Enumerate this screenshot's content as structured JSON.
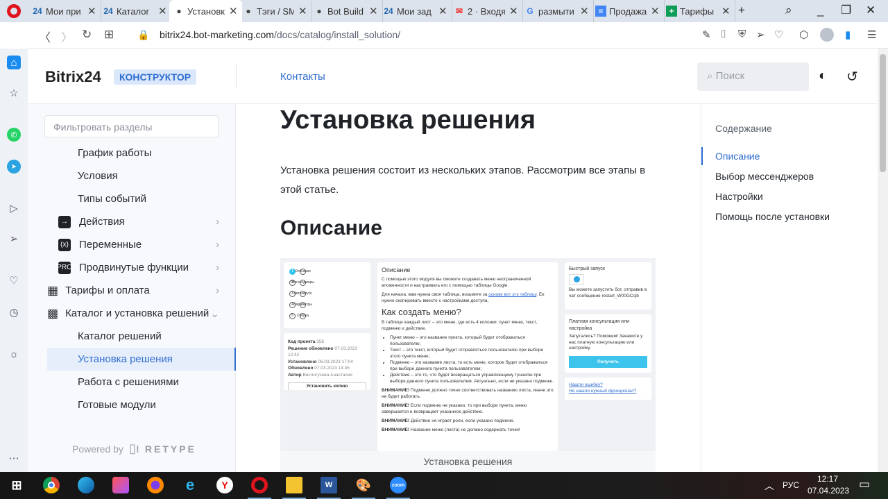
{
  "browser": {
    "tabs": [
      {
        "icon": "24",
        "title": "Мои при"
      },
      {
        "icon": "24",
        "title": "Каталог"
      },
      {
        "icon": "globe",
        "title": "Установк",
        "active": true
      },
      {
        "icon": "globe",
        "title": "Тэги / SM"
      },
      {
        "icon": "globe",
        "title": "Bot Build"
      },
      {
        "icon": "24",
        "title": "Мои зад"
      },
      {
        "icon": "mail",
        "title": "2 · Входя"
      },
      {
        "icon": "G",
        "title": "размыти"
      },
      {
        "icon": "docs",
        "title": "Продажа"
      },
      {
        "icon": "sheets",
        "title": "Тарифы"
      }
    ],
    "url_host": "bitrix24.bot-marketing.com",
    "url_path": "/docs/catalog/install_solution/"
  },
  "header": {
    "logo": "Bitrix24",
    "badge": "КОНСТРУКТОР",
    "contacts": "Контакты",
    "search_placeholder": "Поиск"
  },
  "sidebar": {
    "filter_placeholder": "Фильтровать разделы",
    "items": [
      {
        "label": "График работы"
      },
      {
        "label": "Условия"
      },
      {
        "label": "Типы событий"
      },
      {
        "label": "Действия",
        "icon": "→"
      },
      {
        "label": "Переменные",
        "icon": "(x)"
      },
      {
        "label": "Продвинутые функции",
        "icon": "PRO"
      },
      {
        "label": "Тарифы и оплата"
      },
      {
        "label": "Каталог и установка решений"
      },
      {
        "label": "Каталог решений"
      },
      {
        "label": "Установка решения"
      },
      {
        "label": "Работа с решениями"
      },
      {
        "label": "Готовые модули"
      }
    ],
    "powered_by": "Powered by",
    "retype": "RETYPE"
  },
  "main": {
    "title": "Установка решения",
    "intro": "Установка решения состоит из нескольких этапов. Рассмотрим все этапы в этой статье.",
    "h2": "Описание",
    "caption": "Установка решения",
    "shot": {
      "steps": [
        "Описание",
        "Мессенджеры",
        "Автозапуск",
        "Параметры",
        "Сборка"
      ],
      "meta": [
        [
          "Код проекта",
          "358"
        ],
        [
          "Решение обновлено",
          "07.03.2023 12:42"
        ],
        [
          "Установлено",
          "06.03.2023 17:04"
        ],
        [
          "Обновлено",
          "07.03.2023 14:45"
        ],
        [
          "Автор",
          "Вислогузова Анастасия"
        ]
      ],
      "copy_btn": "Установить копию",
      "art_title": "Описание",
      "p1": "С помощью этого модуля вы сможете создавать меню неограниченной вложенности и настраивать его с помощью таблицы Google.",
      "p2a": "Для начала, вам нужна своя таблица, возьмите за ",
      "p2link": "основу вот эту таблицу",
      "p2b": ". Ее нужно скопировать вместе с настройками доступа.",
      "h3": "Как создать меню?",
      "p3": "В таблице каждый лист – это меню, где есть 4 колонки: пункт меню, текст, подменю и действие.",
      "bullets": [
        "Пункт меню – это название пункта, который будет отображаться пользователю;",
        "Текст – это текст, который будет отправляться пользователю при выборе этого пункта меню;",
        "Подменю – это название листа, то есть меню, которое будет отображаться при выборе данного пункта пользователем;",
        "Действие – это то, что будет возвращаться управляющему туннелю при выборе данного пункта пользователем. Актуально, если не указано подменю."
      ],
      "warn": "ВНИМАНИЕ!",
      "w1": " Подменю должно точно соответствовать названию листа, иначе это не будет работать.",
      "w2": " Если подменю не указано, то при выборе пункта, меню завершается и возвращает указанное действие.",
      "w3": " Действие не играет роли, если указано подменю.",
      "w4": " Название меню (листа) не должно содержать точки!",
      "quick_title": "Быстрый запуск",
      "quick_text": "Вы можете запустить бот, отправив в чат сообщение restart_W00GCcjb",
      "paid_title": "Платная консультация или настройка",
      "paid_text": "Запутались? Поможем! Закажите у нас платную консультацию или настройку.",
      "get_btn": "Получить",
      "link1": "Нашли ошибку?",
      "link2": "Не нашли нужный функционал?"
    }
  },
  "toc": {
    "title": "Содержание",
    "items": [
      "Описание",
      "Выбор мессенджеров",
      "Настройки",
      "Помощь после установки"
    ]
  },
  "taskbar": {
    "zoom": "zoom",
    "lang": "РУС",
    "time": "12:17",
    "date": "07.04.2023"
  }
}
